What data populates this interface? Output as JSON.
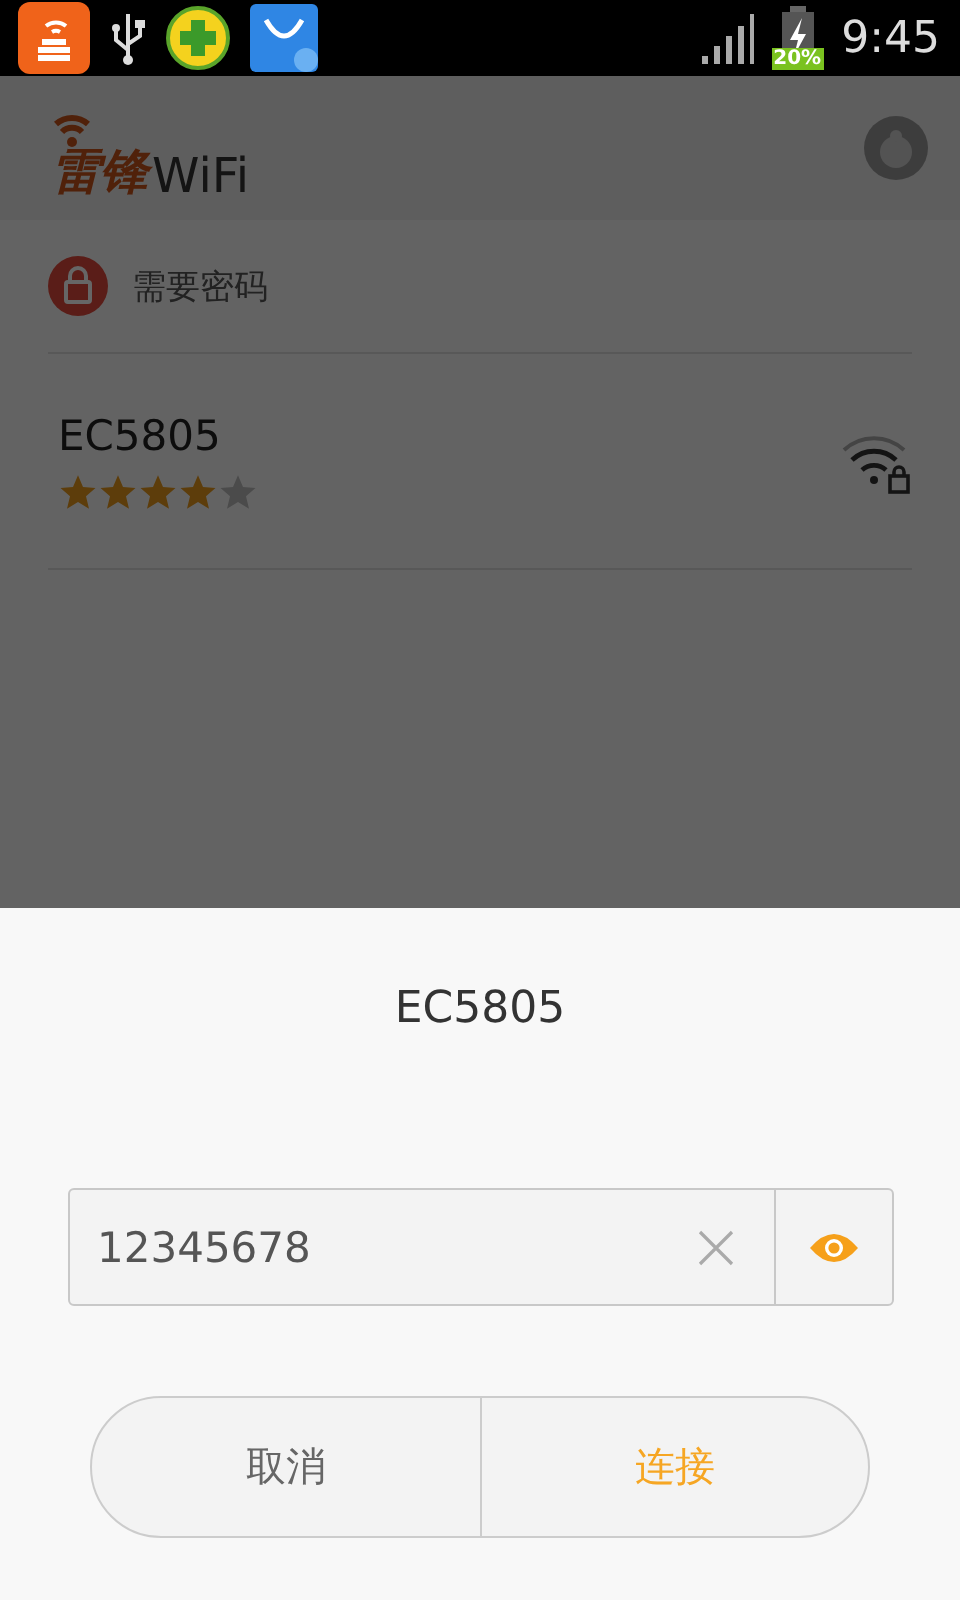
{
  "status_bar": {
    "battery_text": "20%",
    "time": "9:45"
  },
  "app": {
    "logo_text": "雷锋",
    "logo_suffix": "WiFi",
    "section": {
      "label": "需要密码"
    },
    "networks": [
      {
        "name": "EC5805",
        "stars": 4,
        "locked": true
      }
    ]
  },
  "dialog": {
    "title": "EC5805",
    "password": {
      "value": "12345678",
      "visible": true
    },
    "buttons": [
      {
        "label": "取消",
        "kind": "cancel"
      },
      {
        "label": "连接",
        "kind": "confirm"
      }
    ]
  }
}
